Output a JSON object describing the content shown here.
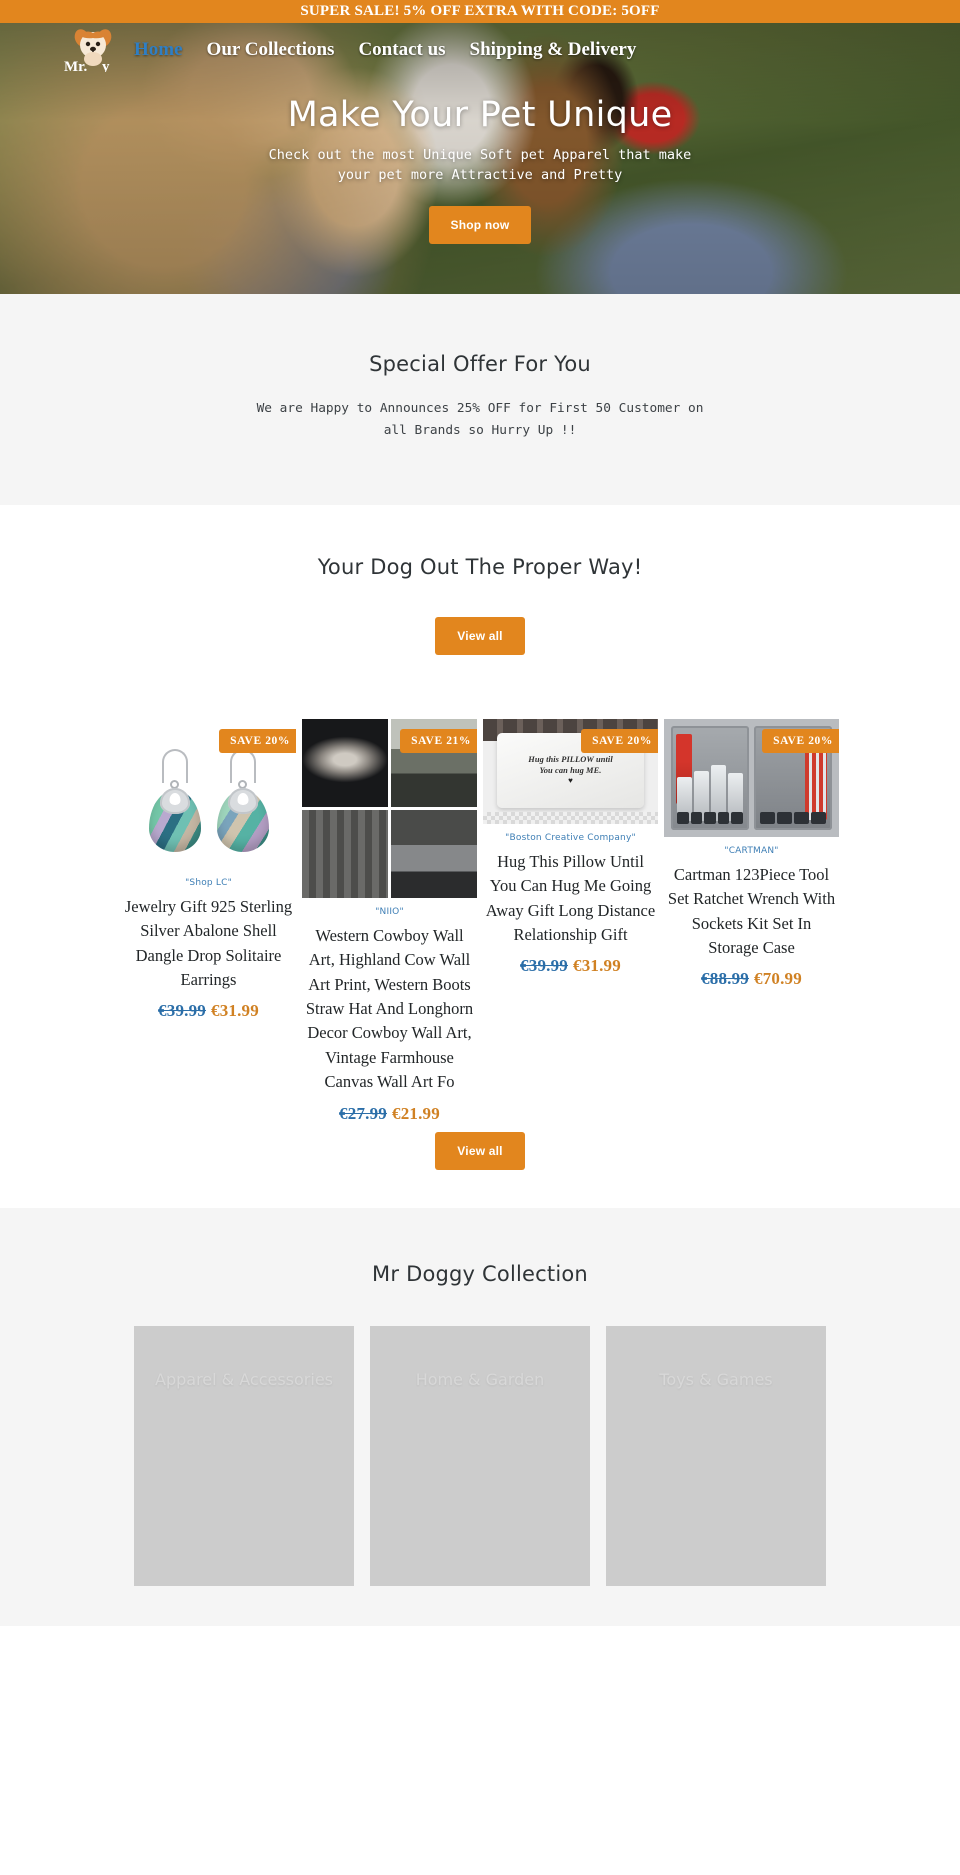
{
  "announcement": {
    "text": "SUPER SALE! 5% OFF EXTRA WITH CODE: 5OFF"
  },
  "nav": {
    "logo_name": "mr-doggy-logo",
    "links": [
      {
        "label": "Home",
        "active": true
      },
      {
        "label": "Our Collections",
        "active": false
      },
      {
        "label": "Contact us",
        "active": false
      },
      {
        "label": "Shipping & Delivery",
        "active": false
      }
    ]
  },
  "hero": {
    "title": "Make Your Pet Unique",
    "subtitle": "Check out the most Unique Soft pet Apparel that make your pet more Attractive and Pretty",
    "cta": "Shop now"
  },
  "offer": {
    "title": "Special Offer For You",
    "body": "We are Happy to Announces 25% OFF for First 50 Customer on all Brands so Hurry Up !!"
  },
  "products_section": {
    "title": "Your Dog Out The Proper Way!",
    "view_all_top": "View all",
    "view_all_bottom": "View all",
    "items": [
      {
        "badge": "SAVE 20%",
        "vendor": "\"Shop LC\"",
        "title": "Jewelry Gift 925 Sterling Silver Abalone Shell Dangle Drop Solitaire Earrings",
        "price_old": "€39.99",
        "price_new": "€31.99"
      },
      {
        "badge": "SAVE 21%",
        "vendor": "\"NIIO\"",
        "title": "Western Cowboy Wall Art, Highland Cow Wall Art Print, Western Boots Straw Hat And Longhorn Decor Cowboy Wall Art, Vintage Farmhouse Canvas Wall Art Fo",
        "price_old": "€27.99",
        "price_new": "€21.99"
      },
      {
        "badge": "SAVE 20%",
        "vendor": "\"Boston Creative Company\"",
        "title": "Hug This Pillow Until You Can Hug Me Going Away Gift Long Distance Relationship Gift",
        "price_old": "€39.99",
        "price_new": "€31.99",
        "pillow_line1": "Hug this PILLOW until",
        "pillow_line2": "You can hug ME."
      },
      {
        "badge": "SAVE 20%",
        "vendor": "\"CARTMAN\"",
        "title": "Cartman 123Piece Tool Set Ratchet Wrench With Sockets Kit Set In Storage Case",
        "price_old": "€88.99",
        "price_new": "€70.99"
      }
    ]
  },
  "collection": {
    "title": "Mr Doggy Collection",
    "cards": [
      {
        "label": "Apparel & Accessories"
      },
      {
        "label": "Home & Garden"
      },
      {
        "label": "Toys & Games"
      }
    ]
  },
  "colors": {
    "accent": "#e2861e",
    "price_old": "#2b6ea8",
    "price_new": "#d08123",
    "vendor": "#3f7fb5",
    "band": "#f5f5f5"
  }
}
